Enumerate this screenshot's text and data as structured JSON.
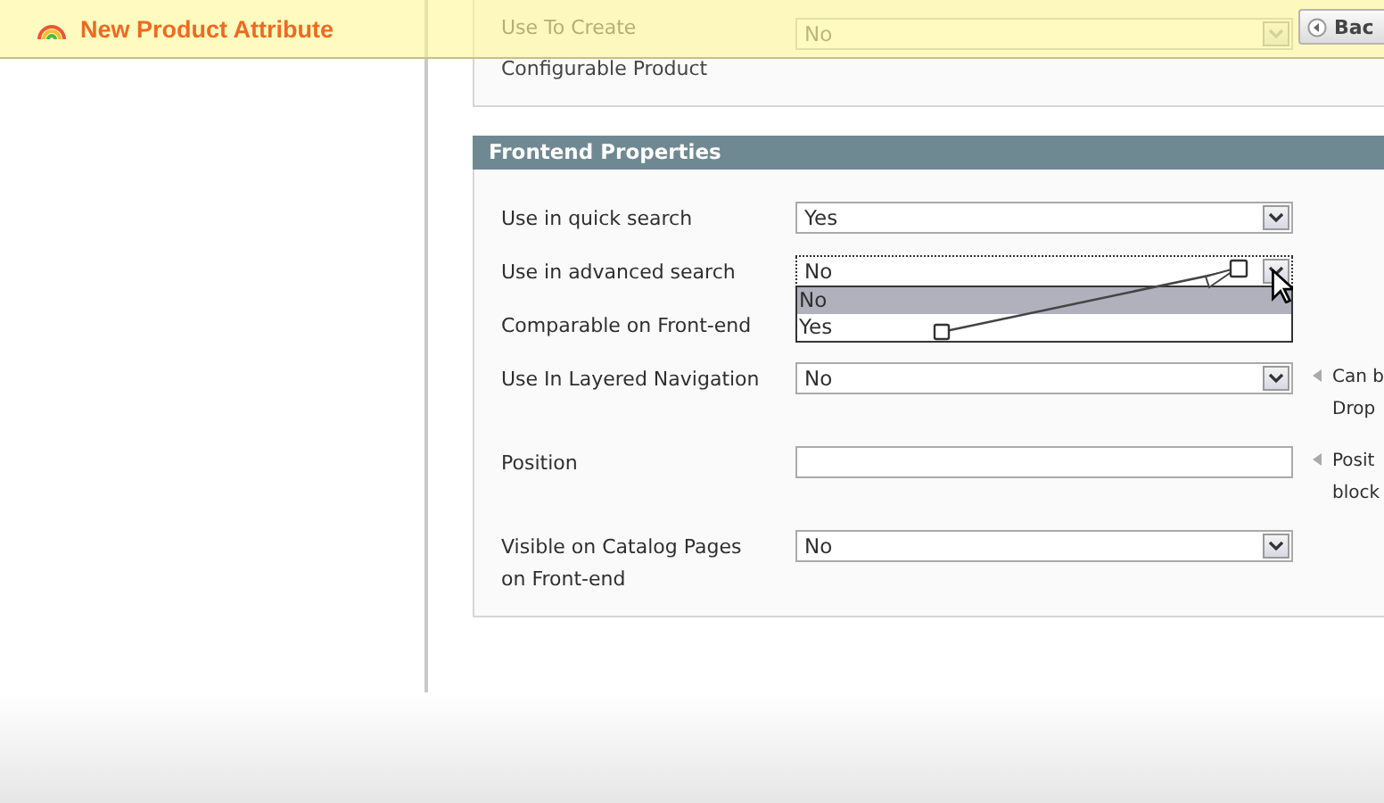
{
  "header": {
    "title": "New Product Attribute"
  },
  "back_button": {
    "label": "Bac"
  },
  "previous_section": {
    "label_lines": [
      "Use To Create",
      "Configurable Product"
    ],
    "value": "No"
  },
  "section": {
    "title": "Frontend Properties",
    "fields": [
      {
        "kind": "select",
        "label_lines": [
          "Use in quick search"
        ],
        "value": "Yes"
      },
      {
        "kind": "select",
        "label_lines": [
          "Use in advanced search"
        ],
        "value": "No",
        "open": true,
        "options": [
          {
            "label": "No",
            "selected": true
          },
          {
            "label": "Yes",
            "selected": false
          }
        ]
      },
      {
        "kind": "label",
        "label_lines": [
          "Comparable on Front-end"
        ]
      },
      {
        "kind": "select",
        "label_lines": [
          "Use In Layered Navigation"
        ],
        "value": "No",
        "note_lines": [
          "Can b",
          "Drop"
        ]
      },
      {
        "kind": "text",
        "label_lines": [
          "Position"
        ],
        "note_lines": [
          "Posit",
          "block"
        ]
      },
      {
        "kind": "select",
        "label_lines": [
          "Visible on Catalog Pages",
          "on Front-end"
        ],
        "value": "No"
      }
    ]
  }
}
